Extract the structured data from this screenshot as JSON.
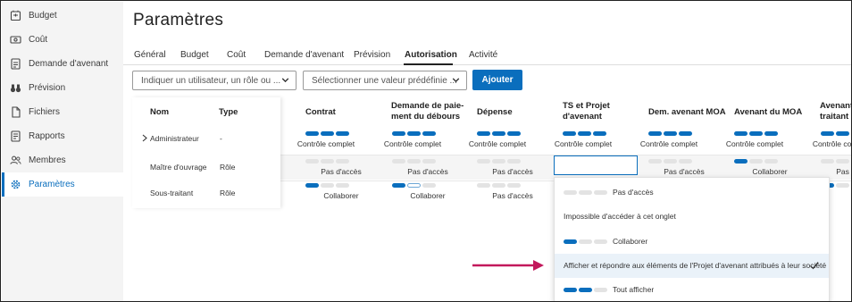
{
  "sidebar": {
    "items": [
      {
        "label": "Budget",
        "icon": "budget-icon"
      },
      {
        "label": "Coût",
        "icon": "cost-icon"
      },
      {
        "label": "Demande d'avenant",
        "icon": "change-request-icon"
      },
      {
        "label": "Prévision",
        "icon": "binoculars-icon"
      },
      {
        "label": "Fichiers",
        "icon": "file-icon"
      },
      {
        "label": "Rapports",
        "icon": "report-icon"
      },
      {
        "label": "Membres",
        "icon": "members-icon"
      },
      {
        "label": "Paramètres",
        "icon": "gear-icon",
        "active": true
      }
    ]
  },
  "page": {
    "title": "Paramètres"
  },
  "tabs": [
    "Général",
    "Budget",
    "Coût",
    "Demande d'avenant",
    "Prévision",
    "Autorisation",
    "Activité"
  ],
  "active_tab": "Autorisation",
  "filters": {
    "user_placeholder": "Indiquer un utilisateur, un rôle ou ...",
    "preset_placeholder": "Sélectionner une valeur prédéfinie ...",
    "add_label": "Ajouter"
  },
  "table": {
    "headers": {
      "name": "Nom",
      "type": "Type"
    },
    "columns": [
      [
        "Contrat"
      ],
      [
        "Demande de paie-",
        "ment du débours"
      ],
      [
        "Dépense"
      ],
      [
        "TS et Projet",
        "d'avenant"
      ],
      [
        "Dem. avenant MOA"
      ],
      [
        "Avenant du MOA"
      ],
      [
        "Avenant",
        "traitant"
      ]
    ],
    "rows": [
      {
        "name": "Administrateur",
        "type": "-",
        "expandable": true,
        "cells": [
          {
            "level": 3,
            "label": "Contrôle complet"
          },
          {
            "level": 3,
            "label": "Contrôle complet"
          },
          {
            "level": 3,
            "label": "Contrôle complet"
          },
          {
            "level": 3,
            "label": "Contrôle complet"
          },
          {
            "level": 3,
            "label": "Contrôle complet"
          },
          {
            "level": 3,
            "label": "Contrôle complet"
          },
          {
            "level": 3,
            "label": "Contrôle complet"
          }
        ]
      },
      {
        "name": "Maître d'ouvrage",
        "type": "Rôle",
        "cells": [
          {
            "level": 0,
            "label": "Pas d'accès"
          },
          {
            "level": 0,
            "label": "Pas d'accès"
          },
          {
            "level": 0,
            "label": "Pas d'accès"
          },
          {
            "level": 1,
            "label": "Collaborer",
            "open": true
          },
          {
            "level": 0,
            "label": "Pas d'accès"
          },
          {
            "level": 1,
            "label": "Collaborer"
          },
          {
            "level": 0,
            "label": "Pas d'accès"
          }
        ]
      },
      {
        "name": "Sous-traitant",
        "type": "Rôle",
        "cells": [
          {
            "level": 1,
            "label": "Collaborer"
          },
          {
            "level": 1,
            "label": "Collaborer",
            "highlight": true
          },
          {
            "level": 0,
            "label": "Pas d'accès"
          },
          null,
          null,
          null,
          {
            "level": 1,
            "label": ""
          }
        ]
      }
    ]
  },
  "dropdown": {
    "options": [
      {
        "label": "Pas d'accès",
        "level": 0,
        "show_bars": true
      },
      {
        "label": "Impossible d'accéder à cet onglet",
        "show_bars": false
      },
      {
        "label": "Collaborer",
        "level": 1,
        "show_bars": true
      },
      {
        "label": "Afficher et répondre aux éléments de l'Projet d'avenant attribués à leur société",
        "show_bars": false,
        "selected": true
      },
      {
        "label": "Tout afficher",
        "level": 2,
        "show_bars": true
      }
    ]
  },
  "colors": {
    "accent": "#0a6ebd",
    "sidebar_bg": "#f4f4f4",
    "arrow": "#c2185b"
  }
}
